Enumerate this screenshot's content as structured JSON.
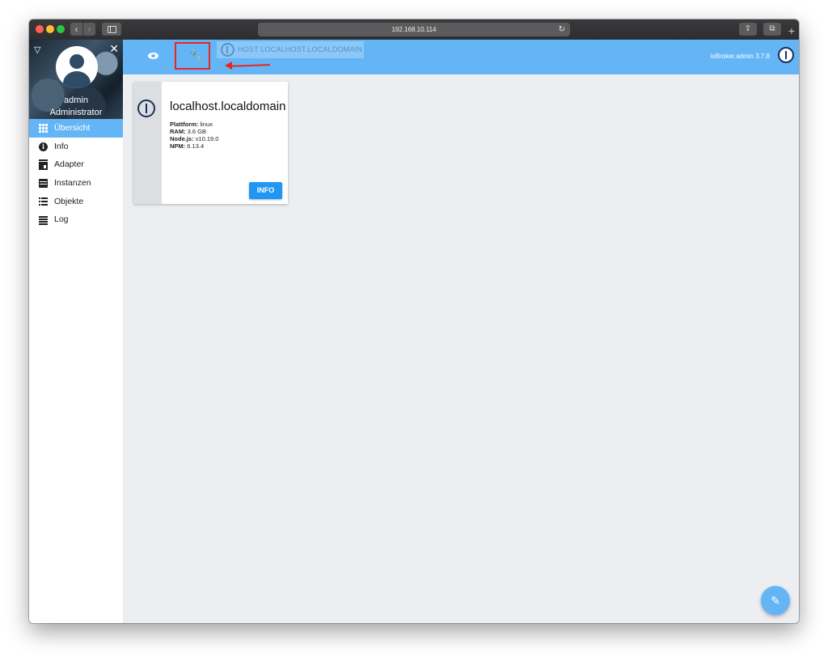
{
  "browser": {
    "url": "192.168.10.114",
    "back_glyph": "‹",
    "forward_glyph": "›",
    "reload_glyph": "↻",
    "share_glyph": "⇪",
    "tabs_glyph": "⧉",
    "newtab_glyph": "+"
  },
  "sidebar": {
    "hamburger_glyph": "▽",
    "close_glyph": "✕",
    "user_name": "admin",
    "user_role": "Administrator",
    "items": [
      {
        "label": "Übersicht",
        "icon": "grid-icon",
        "active": true
      },
      {
        "label": "Info",
        "icon": "info-icon",
        "active": false
      },
      {
        "label": "Adapter",
        "icon": "store-icon",
        "active": false
      },
      {
        "label": "Instanzen",
        "icon": "instances-icon",
        "active": false
      },
      {
        "label": "Objekte",
        "icon": "list-icon",
        "active": false
      },
      {
        "label": "Log",
        "icon": "lines-icon",
        "active": false
      }
    ]
  },
  "appbar": {
    "host_tab_label": "HOST LOCALHOST.LOCALDOMAIN",
    "version": "ioBroker.admin 3.7.8",
    "wrench_glyph": "🔧",
    "accent": "#64b5f6",
    "highlight": "#e8271f"
  },
  "host_card": {
    "title": "localhost.localdomain",
    "platform_label": "Plattform:",
    "platform": "linux",
    "ram_label": "RAM:",
    "ram": "3.6 GB",
    "node_label": "Node.js:",
    "node": "v10.19.0",
    "npm_label": "NPM:",
    "npm": "6.13.4",
    "button": "INFO"
  },
  "fab": {
    "glyph": "✎"
  }
}
